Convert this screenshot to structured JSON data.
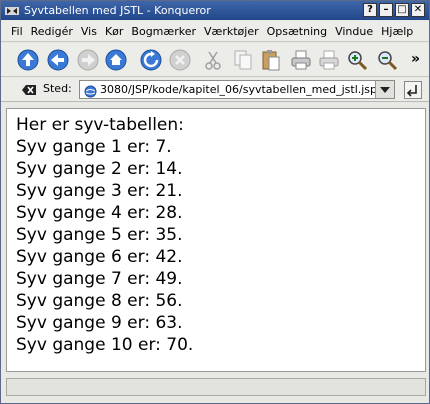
{
  "window": {
    "title": "Syvtabellen med JSTL - Konqueror"
  },
  "title_buttons": [
    "?",
    "–",
    "□",
    "✕"
  ],
  "menu": {
    "items": [
      "Fil",
      "Redigér",
      "Vis",
      "Kør",
      "Bogmærker",
      "Værktøjer",
      "Opsætning",
      "Vindue",
      "Hjælp"
    ]
  },
  "toolbar": {
    "overflow": "»"
  },
  "location": {
    "label": "Sted:",
    "url": "3080/JSP/kode/kapitel_06/syvtabellen_med_jstl.jsp"
  },
  "page": {
    "heading": "Her er syv-tabellen:",
    "lines": [
      "Syv gange 1 er: 7.",
      "Syv gange 2 er: 14.",
      "Syv gange 3 er: 21.",
      "Syv gange 4 er: 28.",
      "Syv gange 5 er: 35.",
      "Syv gange 6 er: 42.",
      "Syv gange 7 er: 49.",
      "Syv gange 8 er: 56.",
      "Syv gange 9 er: 63.",
      "Syv gange 10 er: 70."
    ]
  }
}
